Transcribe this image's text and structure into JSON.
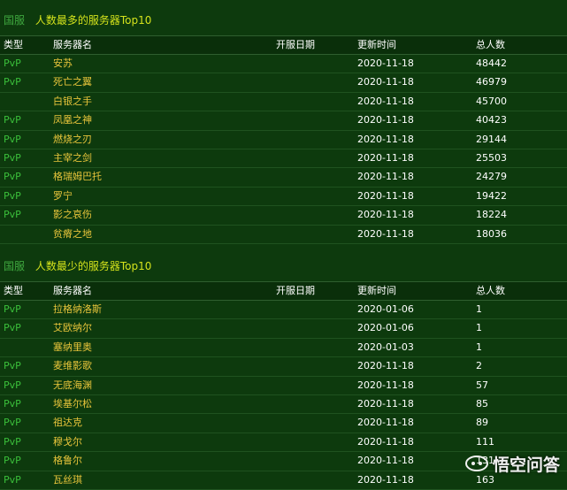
{
  "columns": {
    "type": "类型",
    "name": "服务器名",
    "open_date": "开服日期",
    "update_time": "更新时间",
    "count": "总人数"
  },
  "top": {
    "region": "国服",
    "caption": "人数最多的服务器Top10",
    "rows": [
      {
        "type": "PvP",
        "name": "安苏",
        "open": "",
        "update": "2020-11-18",
        "count": "48442"
      },
      {
        "type": "PvP",
        "name": "死亡之翼",
        "open": "",
        "update": "2020-11-18",
        "count": "46979"
      },
      {
        "type": "",
        "name": "白银之手",
        "open": "",
        "update": "2020-11-18",
        "count": "45700"
      },
      {
        "type": "PvP",
        "name": "凤凰之神",
        "open": "",
        "update": "2020-11-18",
        "count": "40423"
      },
      {
        "type": "PvP",
        "name": "燃烧之刃",
        "open": "",
        "update": "2020-11-18",
        "count": "29144"
      },
      {
        "type": "PvP",
        "name": "主宰之剑",
        "open": "",
        "update": "2020-11-18",
        "count": "25503"
      },
      {
        "type": "PvP",
        "name": "格瑞姆巴托",
        "open": "",
        "update": "2020-11-18",
        "count": "24279"
      },
      {
        "type": "PvP",
        "name": "罗宁",
        "open": "",
        "update": "2020-11-18",
        "count": "19422"
      },
      {
        "type": "PvP",
        "name": "影之哀伤",
        "open": "",
        "update": "2020-11-18",
        "count": "18224"
      },
      {
        "type": "",
        "name": "贫瘠之地",
        "open": "",
        "update": "2020-11-18",
        "count": "18036"
      }
    ]
  },
  "bottom": {
    "region": "国服",
    "caption": "人数最少的服务器Top10",
    "rows": [
      {
        "type": "PvP",
        "name": "拉格纳洛斯",
        "open": "",
        "update": "2020-01-06",
        "count": "1"
      },
      {
        "type": "PvP",
        "name": "艾欧纳尔",
        "open": "",
        "update": "2020-01-06",
        "count": "1"
      },
      {
        "type": "",
        "name": "塞纳里奥",
        "open": "",
        "update": "2020-01-03",
        "count": "1"
      },
      {
        "type": "PvP",
        "name": "麦维影歌",
        "open": "",
        "update": "2020-11-18",
        "count": "2"
      },
      {
        "type": "PvP",
        "name": "无底海渊",
        "open": "",
        "update": "2020-11-18",
        "count": "57"
      },
      {
        "type": "PvP",
        "name": "埃基尔松",
        "open": "",
        "update": "2020-11-18",
        "count": "85"
      },
      {
        "type": "PvP",
        "name": "祖达克",
        "open": "",
        "update": "2020-11-18",
        "count": "89"
      },
      {
        "type": "PvP",
        "name": "穆戈尔",
        "open": "",
        "update": "2020-11-18",
        "count": "111"
      },
      {
        "type": "PvP",
        "name": "格鲁尔",
        "open": "",
        "update": "2020-11-18",
        "count": "131"
      },
      {
        "type": "PvP",
        "name": "瓦丝琪",
        "open": "",
        "update": "2020-11-18",
        "count": "163"
      }
    ]
  },
  "watermark": {
    "text": "悟空问答"
  }
}
